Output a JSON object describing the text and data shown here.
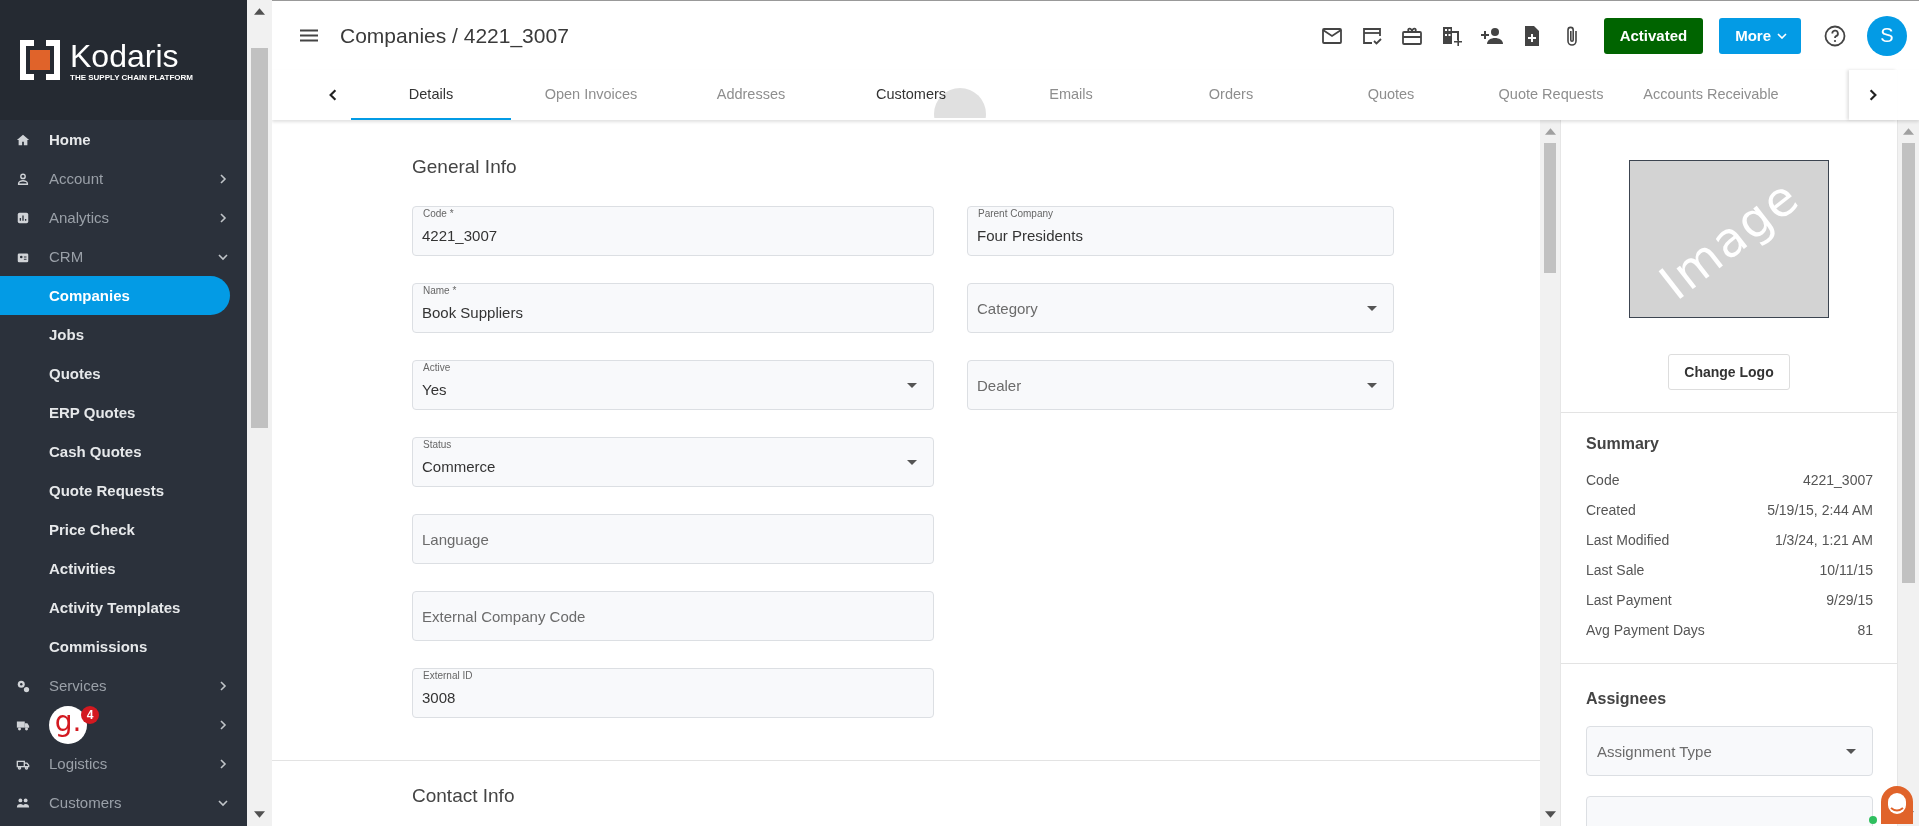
{
  "brand": {
    "name": "Kodaris",
    "tagline": "THE SUPPLY CHAIN PLATFORM"
  },
  "sidebar": {
    "items": [
      {
        "label": "Home",
        "kind": "link",
        "selected": false
      },
      {
        "label": "Account",
        "kind": "group",
        "expanded": false,
        "selected": false
      },
      {
        "label": "Analytics",
        "kind": "group",
        "expanded": false,
        "selected": false
      },
      {
        "label": "CRM",
        "kind": "group",
        "expanded": true,
        "selected": false
      },
      {
        "label": "Companies",
        "kind": "sub",
        "selected": true
      },
      {
        "label": "Jobs",
        "kind": "sub",
        "selected": false
      },
      {
        "label": "Quotes",
        "kind": "sub",
        "selected": false
      },
      {
        "label": "ERP Quotes",
        "kind": "sub",
        "selected": false
      },
      {
        "label": "Cash Quotes",
        "kind": "sub",
        "selected": false
      },
      {
        "label": "Quote Requests",
        "kind": "sub",
        "selected": false
      },
      {
        "label": "Price Check",
        "kind": "sub",
        "selected": false
      },
      {
        "label": "Activities",
        "kind": "sub",
        "selected": false
      },
      {
        "label": "Activity Templates",
        "kind": "sub",
        "selected": false
      },
      {
        "label": "Commissions",
        "kind": "sub",
        "selected": false
      },
      {
        "label": "Services",
        "kind": "group",
        "expanded": false,
        "selected": false
      },
      {
        "kind": "group",
        "expanded": false,
        "selected": false
      },
      {
        "label": "Logistics",
        "kind": "group",
        "expanded": false,
        "selected": false
      },
      {
        "label": "Customers",
        "kind": "group",
        "expanded": true,
        "selected": false
      }
    ]
  },
  "chat_widget": {
    "logo": "g.",
    "count": "4"
  },
  "header": {
    "breadcrumb": "Companies / 4221_3007",
    "status_button": "Activated",
    "more_button": "More",
    "avatar": "S"
  },
  "tabs": [
    {
      "label": "Details",
      "selected": true,
      "hovered": false
    },
    {
      "label": "Open Invoices",
      "selected": false,
      "hovered": false
    },
    {
      "label": "Addresses",
      "selected": false,
      "hovered": false
    },
    {
      "label": "Customers",
      "selected": false,
      "hovered": true
    },
    {
      "label": "Emails",
      "selected": false,
      "hovered": false
    },
    {
      "label": "Orders",
      "selected": false,
      "hovered": false
    },
    {
      "label": "Quotes",
      "selected": false,
      "hovered": false
    },
    {
      "label": "Quote Requests",
      "selected": false,
      "hovered": false
    },
    {
      "label": "Accounts Receivable",
      "selected": false,
      "hovered": false
    }
  ],
  "general_info": {
    "title": "General Info",
    "left_fields": [
      {
        "label": "Code *",
        "value": "4221_3007",
        "kind": "text"
      },
      {
        "label": "Name *",
        "value": "Book Suppliers",
        "kind": "text"
      },
      {
        "label": "Active",
        "value": "Yes",
        "kind": "select"
      },
      {
        "label": "Status",
        "value": "Commerce",
        "kind": "select"
      },
      {
        "placeholder": "Language",
        "kind": "text"
      },
      {
        "placeholder": "External Company Code",
        "kind": "text"
      },
      {
        "label": "External ID",
        "value": "3008",
        "kind": "text"
      }
    ],
    "right_fields": [
      {
        "label": "Parent Company",
        "value": "Four Presidents",
        "kind": "text"
      },
      {
        "placeholder": "Category",
        "kind": "select"
      },
      {
        "placeholder": "Dealer",
        "kind": "select"
      }
    ]
  },
  "contact_info": {
    "title": "Contact Info"
  },
  "side_panel": {
    "logo_placeholder": "Image",
    "change_logo_button": "Change Logo",
    "summary": {
      "title": "Summary",
      "rows": [
        {
          "label": "Code",
          "value": "4221_3007"
        },
        {
          "label": "Created",
          "value": "5/19/15, 2:44 AM"
        },
        {
          "label": "Last Modified",
          "value": "1/3/24, 1:21 AM"
        },
        {
          "label": "Last Sale",
          "value": "10/11/15"
        },
        {
          "label": "Last Payment",
          "value": "9/29/15"
        },
        {
          "label": "Avg Payment Days",
          "value": "81"
        }
      ]
    },
    "assignees": {
      "title": "Assignees",
      "type_field": {
        "placeholder": "Assignment Type",
        "kind": "select"
      }
    }
  }
}
